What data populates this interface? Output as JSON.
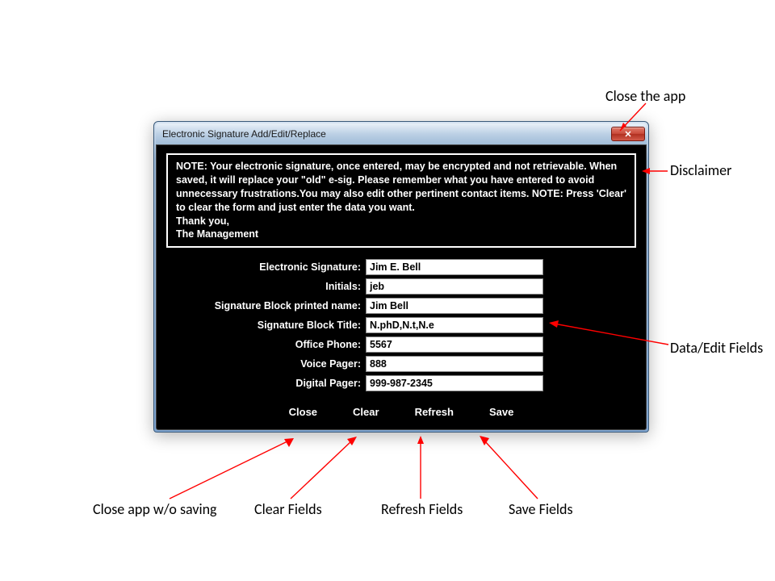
{
  "window": {
    "title": "Electronic Signature Add/Edit/Replace"
  },
  "disclaimer": {
    "text": "NOTE: Your electronic signature, once entered, may be encrypted and not retrievable. When saved, it will replace your \"old\" e-sig. Please remember what you have entered to avoid unnecessary frustrations.You may also edit other pertinent contact items. NOTE: Press 'Clear' to clear the form and just enter the data you want.\nThank you,\nThe Management"
  },
  "fields": {
    "esig": {
      "label": "Electronic Signature:",
      "value": "Jim E. Bell"
    },
    "init": {
      "label": "Initials:",
      "value": "jeb"
    },
    "block": {
      "label": "Signature Block printed name:",
      "value": "Jim Bell"
    },
    "title": {
      "label": "Signature Block Title:",
      "value": "N.phD,N.t,N.e"
    },
    "office": {
      "label": "Office Phone:",
      "value": "5567"
    },
    "voice": {
      "label": "Voice Pager:",
      "value": "888"
    },
    "digital": {
      "label": "Digital Pager:",
      "value": "999-987-2345"
    }
  },
  "actions": {
    "close": "Close",
    "clear": "Clear",
    "refresh": "Refresh",
    "save": "Save"
  },
  "annotations": {
    "close_app": "Close the app",
    "disclaimer": "Disclaimer",
    "data_fields": "Data/Edit Fields",
    "close_no_save": "Close app w/o saving",
    "clear_fields": "Clear Fields",
    "refresh_fields": "Refresh Fields",
    "save_fields": "Save Fields"
  }
}
